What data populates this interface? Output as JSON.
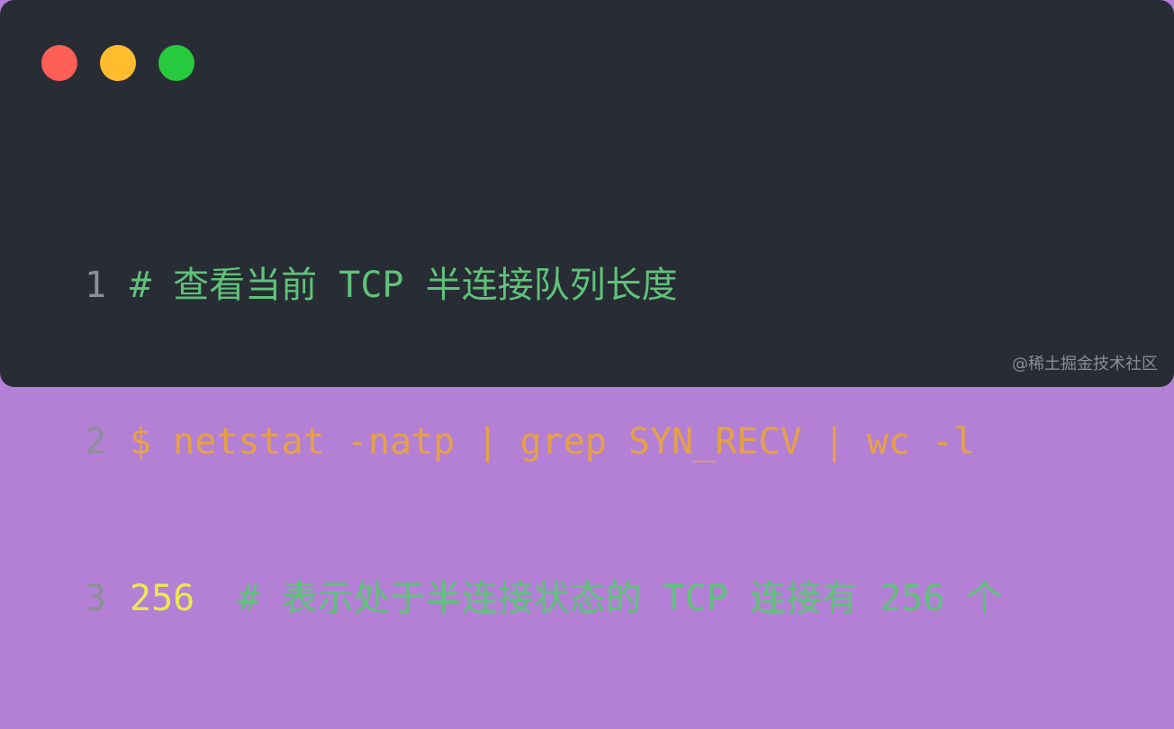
{
  "window": {
    "controls": [
      {
        "name": "close",
        "color": "#ff5f56"
      },
      {
        "name": "minimize",
        "color": "#ffbd2e"
      },
      {
        "name": "maximize",
        "color": "#27c93f"
      }
    ]
  },
  "code": {
    "lines": [
      {
        "number": "1",
        "segments": [
          {
            "type": "comment",
            "text": "# 查看当前 TCP 半连接队列长度"
          }
        ]
      },
      {
        "number": "2",
        "segments": [
          {
            "type": "prompt",
            "text": "$ "
          },
          {
            "type": "cmd",
            "text": "netstat -natp | grep SYN_RECV | wc -l"
          }
        ]
      },
      {
        "number": "3",
        "segments": [
          {
            "type": "num",
            "text": "256"
          },
          {
            "type": "plain",
            "text": "  "
          },
          {
            "type": "comment",
            "text": "# 表示处于半连接状态的 TCP 连接有 256 个"
          }
        ]
      }
    ]
  },
  "watermark": "@稀土掘金技术社区"
}
